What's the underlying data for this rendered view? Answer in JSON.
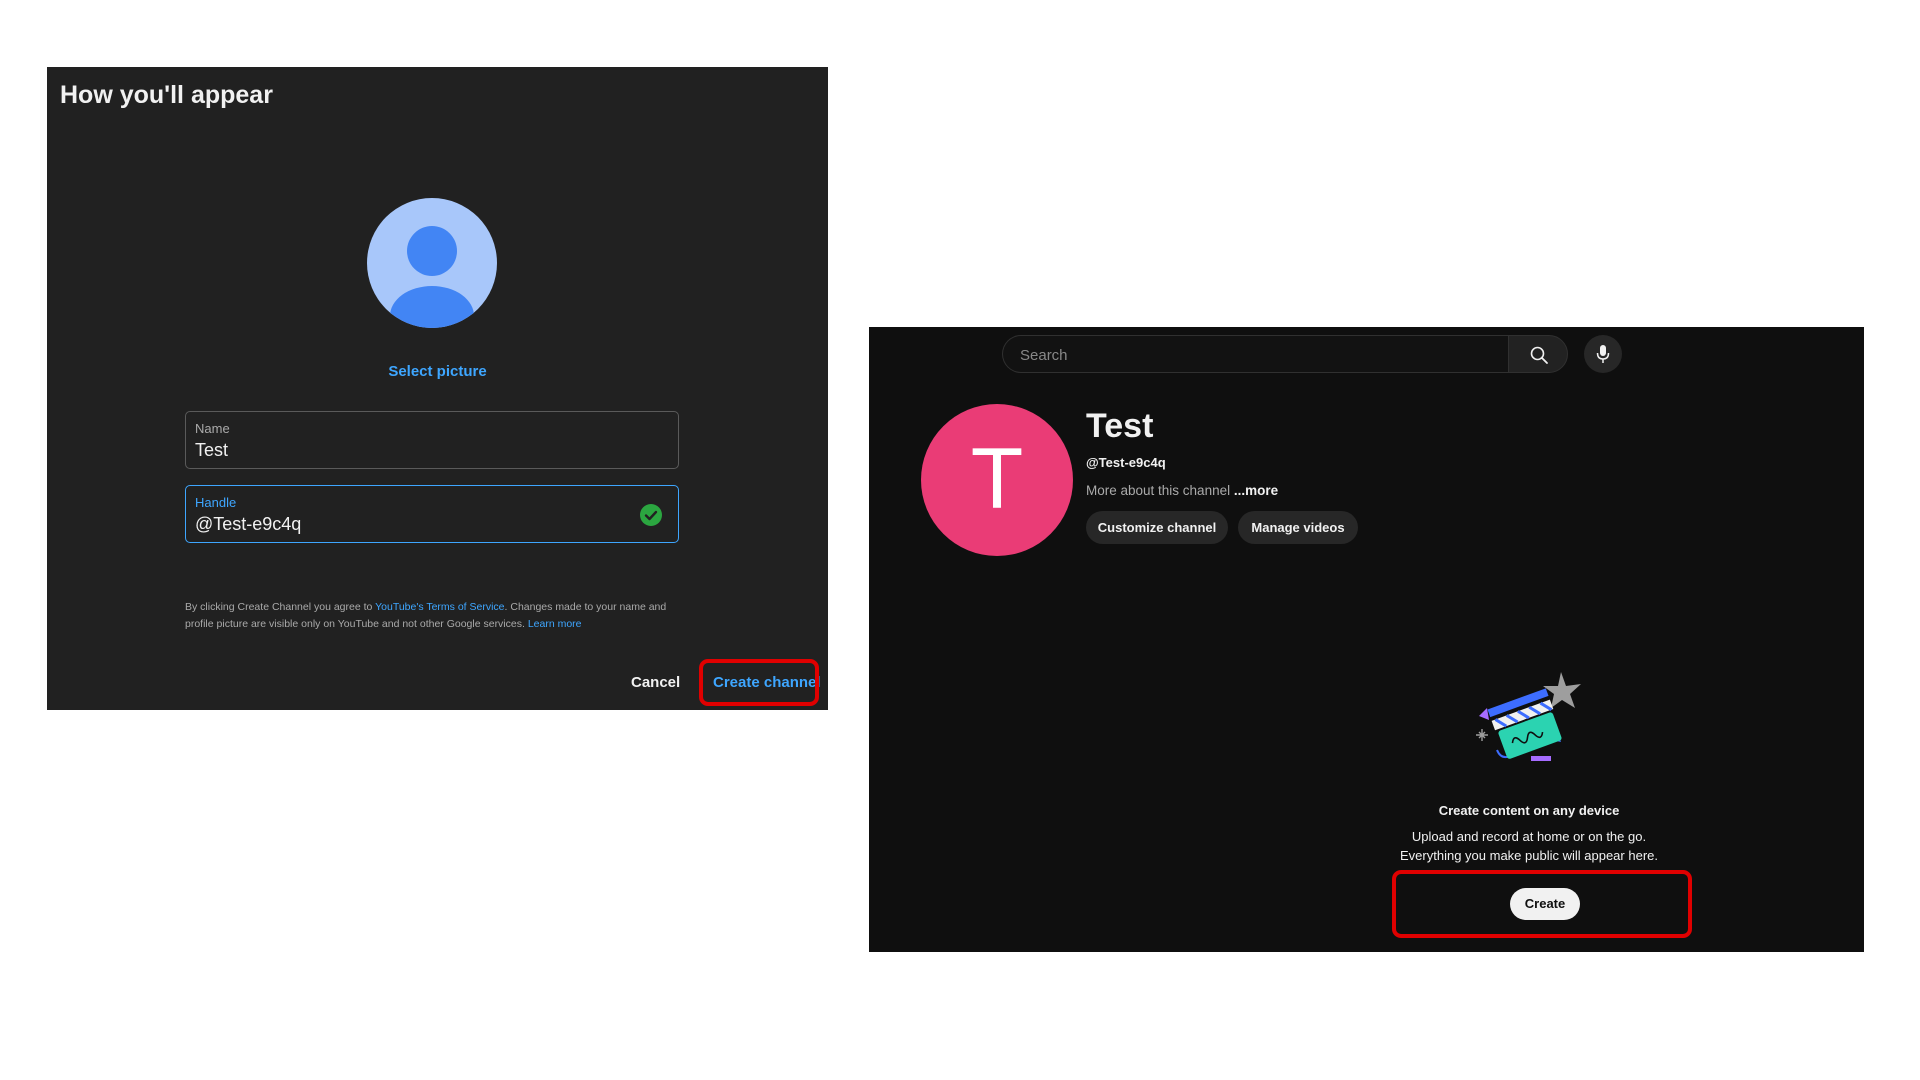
{
  "dialog": {
    "title": "How you'll appear",
    "select_picture": "Select picture",
    "name_field": {
      "label": "Name",
      "value": "Test"
    },
    "handle_field": {
      "label": "Handle",
      "value": "@Test-e9c4q"
    },
    "terms": {
      "prefix": "By clicking Create Channel you agree to",
      "tos_link": "YouTube's Terms of Service",
      "middle": ". Changes made to your name and profile picture are visible only on YouTube and not other Google services.",
      "learn_more": "Learn more"
    },
    "cancel_label": "Cancel",
    "create_channel_label": "Create channel"
  },
  "channel_page": {
    "search": {
      "placeholder": "Search"
    },
    "channel": {
      "avatar_letter": "T",
      "name": "Test",
      "handle": "@Test-e9c4q",
      "about": "More about this channel",
      "more_link": "...more"
    },
    "buttons": {
      "customize": "Customize channel",
      "manage": "Manage videos"
    },
    "empty_state": {
      "title": "Create content on any device",
      "line1": "Upload and record at home or on the go.",
      "line2": "Everything you make public will appear here.",
      "create_label": "Create"
    }
  },
  "colors": {
    "dialog_bg": "#212121",
    "page_bg": "#0f0f0f",
    "link_blue": "#3ea6ff",
    "avatar_pink": "#ea3c76",
    "highlight_red": "#e00000",
    "check_green": "#2ba640"
  },
  "icons": [
    "default-avatar-icon",
    "check-circle-icon",
    "search-icon",
    "microphone-icon",
    "clapperboard-illustration"
  ]
}
